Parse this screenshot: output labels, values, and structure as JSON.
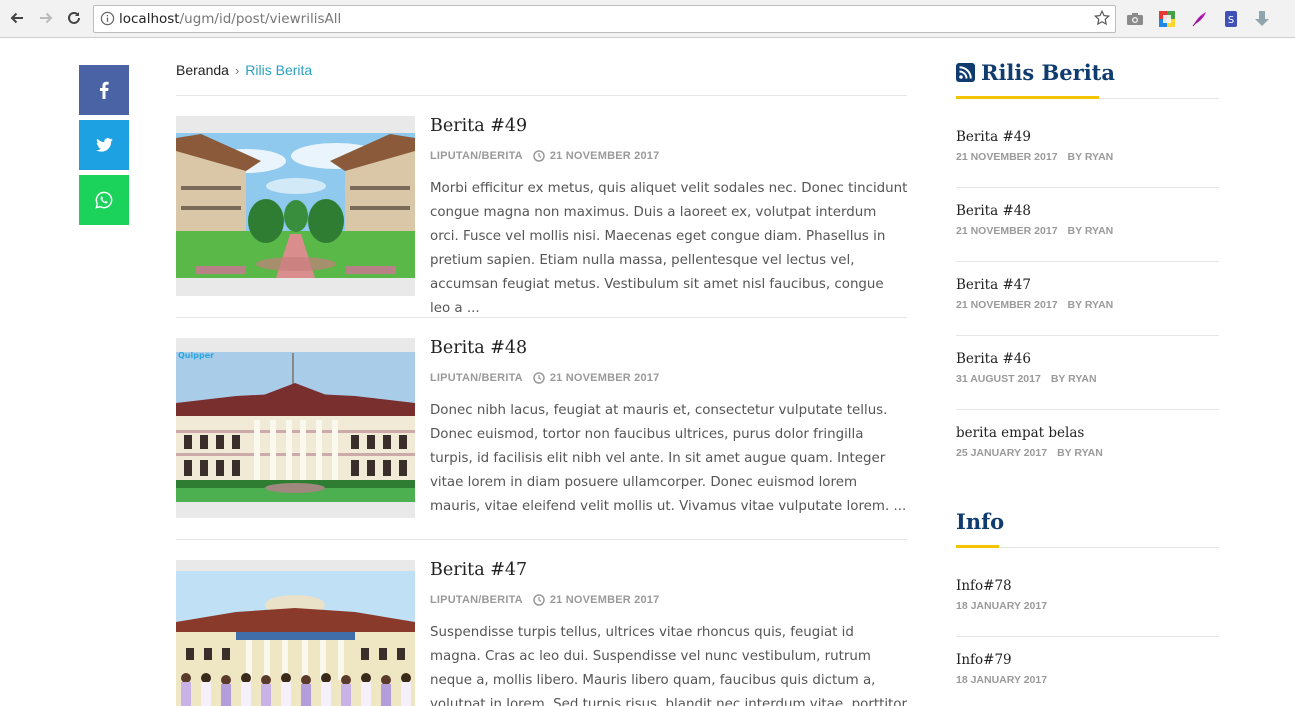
{
  "browser": {
    "url_host": "localhost",
    "url_path": "/ugm/id/post/viewrilisAll"
  },
  "colors": {
    "facebook": "#4a63a5",
    "twitter": "#1da1e2",
    "whatsapp": "#1bd35b",
    "accent": "#f5c400",
    "heading": "#0f3b6e",
    "link": "#2aa1c0"
  },
  "share": {
    "icons": [
      "facebook-icon",
      "twitter-icon",
      "whatsapp-icon"
    ]
  },
  "breadcrumb": {
    "home": "Beranda",
    "separator": "›",
    "current": "Rilis Berita"
  },
  "posts": [
    {
      "title": "Berita #49",
      "category": "LIPUTAN/BERITA",
      "date": "21 NOVEMBER 2017",
      "excerpt": "Morbi efficitur ex metus, quis aliquet velit sodales nec. Donec tincidunt congue magna non maximus. Duis a laoreet ex, volutpat interdum orci. Fusce vel mollis nisi. Maecenas eget congue diam. Phasellus in pretium sapien. Etiam nulla massa, pellentesque vel lectus vel, accumsan feugiat metus. Vestibulum sit amet nisl faucibus, congue leo a ..."
    },
    {
      "title": "Berita #48",
      "category": "LIPUTAN/BERITA",
      "date": "21 NOVEMBER 2017",
      "image_text": "Quipper",
      "excerpt": "Donec nibh lacus, feugiat at mauris et, consectetur vulputate tellus. Donec euismod, tortor non faucibus ultrices, purus dolor fringilla turpis, id facilisis elit nibh vel ante. In sit amet augue quam. Integer vitae lorem in diam posuere ullamcorper. Donec euismod lorem mauris, vitae eleifend velit mollis ut. Vivamus vitae vulputate lorem. ..."
    },
    {
      "title": "Berita #47",
      "category": "LIPUTAN/BERITA",
      "date": "21 NOVEMBER 2017",
      "excerpt": "Suspendisse turpis tellus, ultrices vitae rhoncus quis, feugiat id magna. Cras ac leo dui. Suspendisse vel nunc vestibulum, rutrum neque a, mollis libero. Mauris libero quam, faucibus quis dictum a, volutpat in lorem. Sed turpis risus, blandit nec interdum vitae, porttitor id magna. Nullam"
    }
  ],
  "sidebar": {
    "rilis": {
      "heading": "Rilis Berita",
      "items": [
        {
          "title": "Berita #49",
          "date": "21 NOVEMBER 2017",
          "author": "BY RYAN"
        },
        {
          "title": "Berita #48",
          "date": "21 NOVEMBER 2017",
          "author": "BY RYAN"
        },
        {
          "title": "Berita #47",
          "date": "21 NOVEMBER 2017",
          "author": "BY RYAN"
        },
        {
          "title": "Berita #46",
          "date": "31 AUGUST 2017",
          "author": "BY RYAN"
        },
        {
          "title": "berita empat belas",
          "date": "25 JANUARY 2017",
          "author": "BY RYAN"
        }
      ]
    },
    "info": {
      "heading": "Info",
      "items": [
        {
          "title": "Info#78",
          "date": "18 JANUARY 2017"
        },
        {
          "title": "Info#79",
          "date": "18 JANUARY 2017"
        }
      ]
    }
  }
}
